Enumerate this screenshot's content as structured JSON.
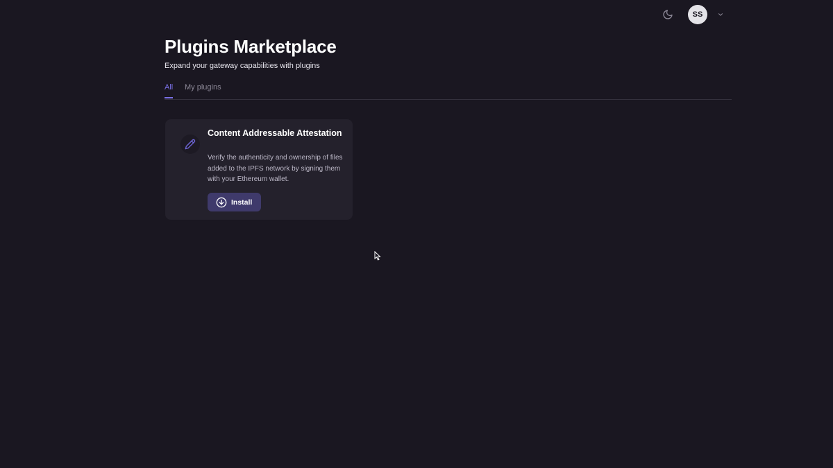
{
  "header": {
    "theme_toggle_icon": "moon-icon",
    "avatar_initials": "SS",
    "account_menu_icon": "chevron-down-icon"
  },
  "page": {
    "title": "Plugins Marketplace",
    "subtitle": "Expand your gateway capabilities with plugins"
  },
  "tabs": [
    {
      "label": "All",
      "active": true
    },
    {
      "label": "My plugins",
      "active": false
    }
  ],
  "plugins": [
    {
      "icon": "pencil-icon",
      "title": "Content Addressable Attestation",
      "description": "Verify the authenticity and ownership of files added to the IPFS network by signing them with your Ethereum wallet.",
      "action_label": "Install",
      "action_icon": "download-circle-icon"
    }
  ],
  "colors": {
    "background": "#1a1721",
    "card": "#24212c",
    "accent": "#7a70e6",
    "button": "#3f3a6b"
  }
}
